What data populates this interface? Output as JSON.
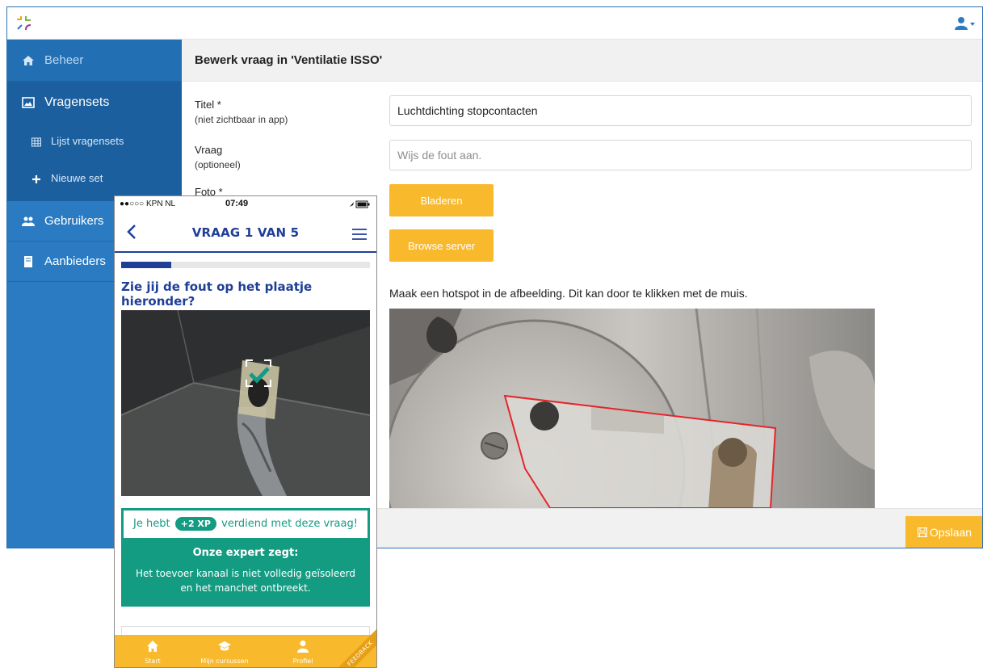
{
  "sidebar": {
    "items": [
      {
        "label": "Beheer",
        "icon": "home-icon"
      },
      {
        "label": "Vragensets",
        "icon": "image-icon",
        "children": [
          {
            "label": "Lijst vragensets",
            "icon": "table-icon"
          },
          {
            "label": "Nieuwe set",
            "icon": "plus-icon"
          }
        ]
      },
      {
        "label": "Gebruikers",
        "icon": "users-icon"
      },
      {
        "label": "Aanbieders",
        "icon": "book-icon"
      }
    ]
  },
  "topbar": {
    "user_icon": "user-icon"
  },
  "main": {
    "title": "Bewerk vraag in 'Ventilatie ISSO'",
    "fields": {
      "titel": {
        "label": "Titel *",
        "hint": "(niet zichtbaar in app)",
        "value": "Luchtdichting stopcontacten"
      },
      "vraag": {
        "label": "Vraag",
        "hint": "(optioneel)",
        "placeholder": "Wijs de fout aan."
      },
      "foto": {
        "label": "Foto *"
      }
    },
    "buttons": {
      "browse": "Bladeren",
      "browse_server": "Browse server",
      "save": "Opslaan"
    },
    "hotspot_instruction": "Maak een hotspot in de afbeelding. Dit kan door te klikken met de muis."
  },
  "phone": {
    "carrier": "●●○○○ KPN NL",
    "time": "07:49",
    "nav_title": "VRAAG 1 VAN 5",
    "progress": 0.2,
    "question": "Zie jij de fout op het plaatje hieronder?",
    "earned_before": "Je hebt",
    "xp_badge": "+2 XP",
    "earned_after": "verdiend met deze vraag!",
    "expert_head": "Onze expert zegt:",
    "expert_text": "Het toevoer kanaal is niet volledig geïsoleerd en het manchet ontbreekt.",
    "tabs": [
      {
        "label": "Start",
        "icon": "home-icon"
      },
      {
        "label": "Mijn cursussen",
        "icon": "graduation-cap-icon"
      },
      {
        "label": "Profiel",
        "icon": "user-icon"
      }
    ],
    "ribbon": "FEEDBACK"
  },
  "colors": {
    "sidebar": "#2b7bc3",
    "sidebar_active": "#1c5f9e",
    "accent_yellow": "#f9b92c",
    "phone_navy": "#1f3f97",
    "phone_teal": "#139c82",
    "hotspot_red": "#e3262b"
  }
}
